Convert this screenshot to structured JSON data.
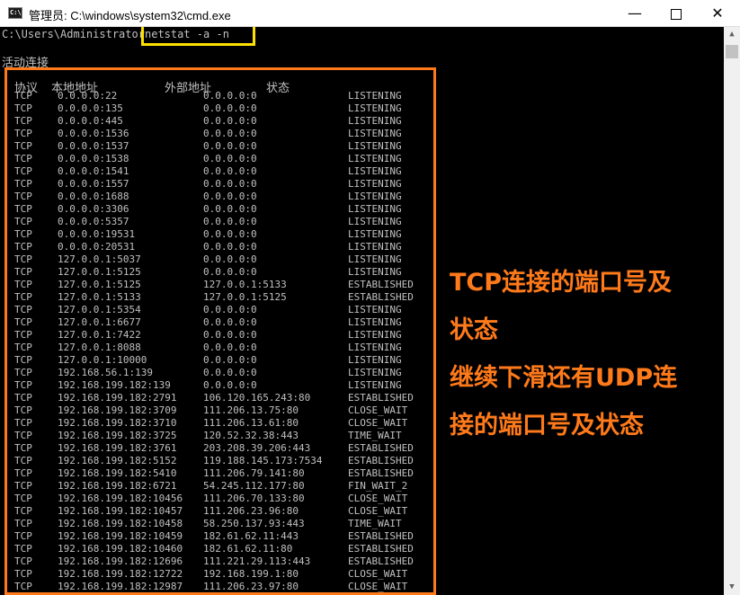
{
  "window": {
    "icon_text": "C:\\",
    "title": "管理员: C:\\windows\\system32\\cmd.exe",
    "minimize_label": "—",
    "close_label": "✕"
  },
  "console": {
    "prompt": "C:\\Users\\Administrator",
    "command": "netstat -a -n",
    "section_title": "活动连接",
    "headers": {
      "proto": "协议",
      "local": "本地地址",
      "foreign": "外部地址",
      "state": "状态"
    },
    "rows": [
      [
        "TCP",
        "0.0.0.0:22",
        "0.0.0.0:0",
        "LISTENING"
      ],
      [
        "TCP",
        "0.0.0.0:135",
        "0.0.0.0:0",
        "LISTENING"
      ],
      [
        "TCP",
        "0.0.0.0:445",
        "0.0.0.0:0",
        "LISTENING"
      ],
      [
        "TCP",
        "0.0.0.0:1536",
        "0.0.0.0:0",
        "LISTENING"
      ],
      [
        "TCP",
        "0.0.0.0:1537",
        "0.0.0.0:0",
        "LISTENING"
      ],
      [
        "TCP",
        "0.0.0.0:1538",
        "0.0.0.0:0",
        "LISTENING"
      ],
      [
        "TCP",
        "0.0.0.0:1541",
        "0.0.0.0:0",
        "LISTENING"
      ],
      [
        "TCP",
        "0.0.0.0:1557",
        "0.0.0.0:0",
        "LISTENING"
      ],
      [
        "TCP",
        "0.0.0.0:1688",
        "0.0.0.0:0",
        "LISTENING"
      ],
      [
        "TCP",
        "0.0.0.0:3306",
        "0.0.0.0:0",
        "LISTENING"
      ],
      [
        "TCP",
        "0.0.0.0:5357",
        "0.0.0.0:0",
        "LISTENING"
      ],
      [
        "TCP",
        "0.0.0.0:19531",
        "0.0.0.0:0",
        "LISTENING"
      ],
      [
        "TCP",
        "0.0.0.0:20531",
        "0.0.0.0:0",
        "LISTENING"
      ],
      [
        "TCP",
        "127.0.0.1:5037",
        "0.0.0.0:0",
        "LISTENING"
      ],
      [
        "TCP",
        "127.0.0.1:5125",
        "0.0.0.0:0",
        "LISTENING"
      ],
      [
        "TCP",
        "127.0.0.1:5125",
        "127.0.0.1:5133",
        "ESTABLISHED"
      ],
      [
        "TCP",
        "127.0.0.1:5133",
        "127.0.0.1:5125",
        "ESTABLISHED"
      ],
      [
        "TCP",
        "127.0.0.1:5354",
        "0.0.0.0:0",
        "LISTENING"
      ],
      [
        "TCP",
        "127.0.0.1:6677",
        "0.0.0.0:0",
        "LISTENING"
      ],
      [
        "TCP",
        "127.0.0.1:7422",
        "0.0.0.0:0",
        "LISTENING"
      ],
      [
        "TCP",
        "127.0.0.1:8088",
        "0.0.0.0:0",
        "LISTENING"
      ],
      [
        "TCP",
        "127.0.0.1:10000",
        "0.0.0.0:0",
        "LISTENING"
      ],
      [
        "TCP",
        "192.168.56.1:139",
        "0.0.0.0:0",
        "LISTENING"
      ],
      [
        "TCP",
        "192.168.199.182:139",
        "0.0.0.0:0",
        "LISTENING"
      ],
      [
        "TCP",
        "192.168.199.182:2791",
        "106.120.165.243:80",
        "ESTABLISHED"
      ],
      [
        "TCP",
        "192.168.199.182:3709",
        "111.206.13.75:80",
        "CLOSE_WAIT"
      ],
      [
        "TCP",
        "192.168.199.182:3710",
        "111.206.13.61:80",
        "CLOSE_WAIT"
      ],
      [
        "TCP",
        "192.168.199.182:3725",
        "120.52.32.38:443",
        "TIME_WAIT"
      ],
      [
        "TCP",
        "192.168.199.182:3761",
        "203.208.39.206:443",
        "ESTABLISHED"
      ],
      [
        "TCP",
        "192.168.199.182:5152",
        "119.188.145.173:7534",
        "ESTABLISHED"
      ],
      [
        "TCP",
        "192.168.199.182:5410",
        "111.206.79.141:80",
        "ESTABLISHED"
      ],
      [
        "TCP",
        "192.168.199.182:6721",
        "54.245.112.177:80",
        "FIN_WAIT_2"
      ],
      [
        "TCP",
        "192.168.199.182:10456",
        "111.206.70.133:80",
        "CLOSE_WAIT"
      ],
      [
        "TCP",
        "192.168.199.182:10457",
        "111.206.23.96:80",
        "CLOSE_WAIT"
      ],
      [
        "TCP",
        "192.168.199.182:10458",
        "58.250.137.93:443",
        "TIME_WAIT"
      ],
      [
        "TCP",
        "192.168.199.182:10459",
        "182.61.62.11:443",
        "ESTABLISHED"
      ],
      [
        "TCP",
        "192.168.199.182:10460",
        "182.61.62.11:80",
        "ESTABLISHED"
      ],
      [
        "TCP",
        "192.168.199.182:12696",
        "111.221.29.113:443",
        "ESTABLISHED"
      ],
      [
        "TCP",
        "192.168.199.182:12722",
        "192.168.199.1:80",
        "CLOSE_WAIT"
      ],
      [
        "TCP",
        "192.168.199.182:12987",
        "111.206.23.97:80",
        "CLOSE_WAIT"
      ]
    ]
  },
  "annotation": {
    "lines": [
      "TCP连接的端口号及",
      "状态",
      "继续下滑还有UDP连",
      "接的端口号及状态"
    ]
  },
  "colors": {
    "highlight_command": "#ffe100",
    "highlight_table": "#ff7a1a",
    "console_text": "#c0c0c0",
    "console_bg": "#000000"
  }
}
